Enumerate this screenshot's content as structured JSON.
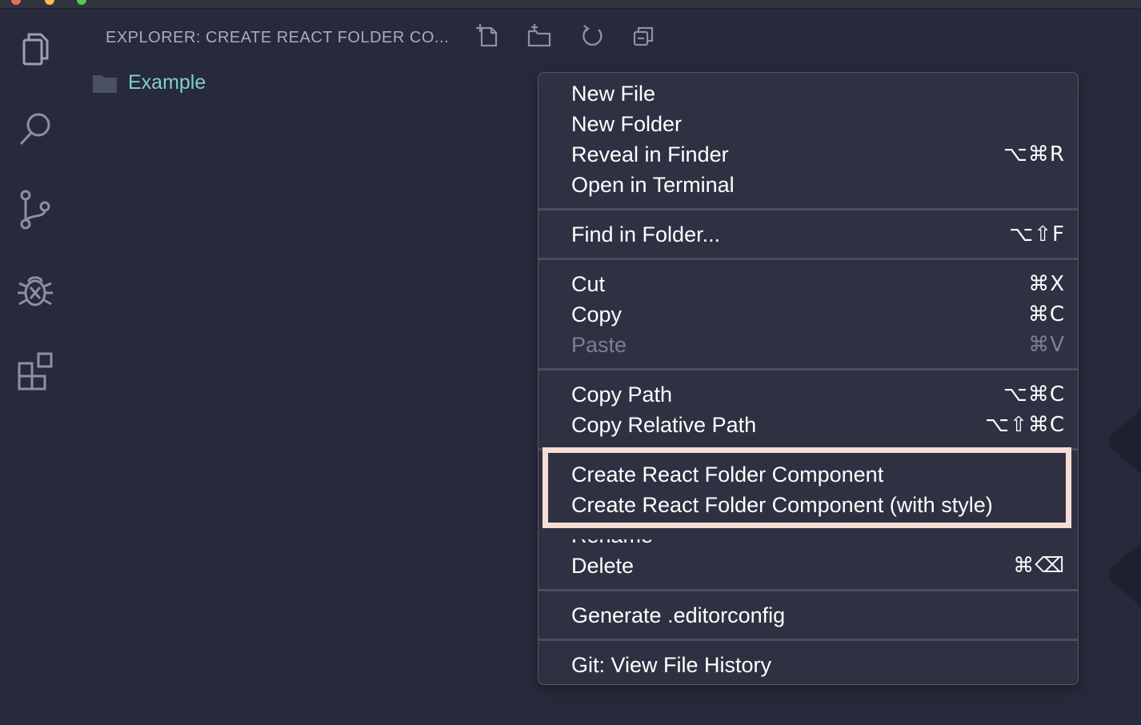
{
  "window": {
    "title": ""
  },
  "activity_bar": {
    "items": [
      {
        "name": "explorer-icon"
      },
      {
        "name": "search-icon"
      },
      {
        "name": "source-control-icon"
      },
      {
        "name": "debug-icon"
      },
      {
        "name": "extensions-icon"
      }
    ]
  },
  "explorer": {
    "title": "EXPLORER: CREATE REACT FOLDER CO...",
    "toolbar": [
      "new-file-icon",
      "new-folder-icon",
      "refresh-icon",
      "collapse-all-icon"
    ],
    "tree": [
      {
        "label": "Example",
        "type": "folder"
      }
    ]
  },
  "context_menu": {
    "items": [
      {
        "label": "New File",
        "shortcut": ""
      },
      {
        "label": "New Folder",
        "shortcut": ""
      },
      {
        "label": "Reveal in Finder",
        "shortcut": "⌥⌘R"
      },
      {
        "label": "Open in Terminal",
        "shortcut": ""
      },
      {
        "label": "Find in Folder...",
        "shortcut": "⌥⇧F"
      },
      {
        "label": "Cut",
        "shortcut": "⌘X"
      },
      {
        "label": "Copy",
        "shortcut": "⌘C"
      },
      {
        "label": "Paste",
        "shortcut": "⌘V",
        "disabled": true
      },
      {
        "label": "Copy Path",
        "shortcut": "⌥⌘C"
      },
      {
        "label": "Copy Relative Path",
        "shortcut": "⌥⇧⌘C"
      },
      {
        "label": "Create React Folder Component",
        "shortcut": ""
      },
      {
        "label": "Create React Folder Component (with style)",
        "shortcut": ""
      },
      {
        "label": "Rename",
        "shortcut": "↩"
      },
      {
        "label": "Delete",
        "shortcut": "⌘⌫"
      },
      {
        "label": "Generate .editorconfig",
        "shortcut": ""
      },
      {
        "label": "Git: View File History",
        "shortcut": ""
      }
    ],
    "highlight_color": "#f7ddd6"
  },
  "colors": {
    "background": "#272a3b",
    "menu_background": "#2f3142",
    "folder_label": "#7fd1c6",
    "icon": "#8b8fa8"
  }
}
